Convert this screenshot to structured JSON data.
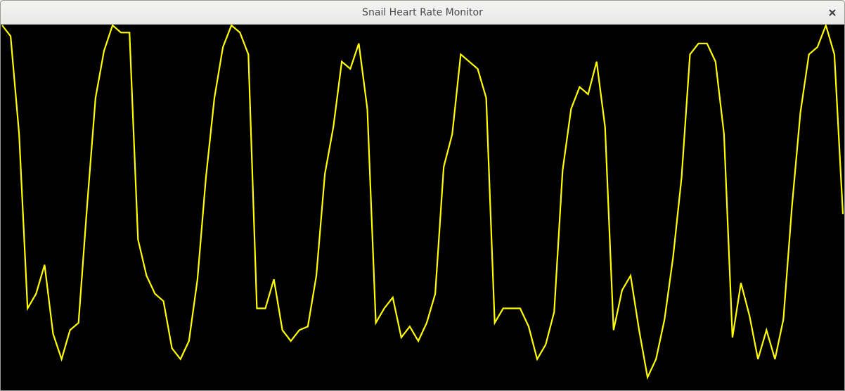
{
  "window": {
    "title": "Snail Heart Rate Monitor",
    "close_icon": "close-icon"
  },
  "colors": {
    "trace": "#ffff00",
    "background": "#000000"
  },
  "chart_data": {
    "type": "line",
    "xlabel": "",
    "ylabel": "",
    "grid": false,
    "legend": "none",
    "ylim": [
      0,
      100
    ],
    "series": [
      {
        "values": [
          100,
          97,
          70,
          22,
          26,
          34,
          15,
          8,
          16,
          18,
          50,
          80,
          93,
          100,
          98,
          98,
          41,
          31,
          26,
          24,
          11,
          8,
          13,
          30,
          58,
          80,
          94,
          100,
          98,
          92,
          22,
          22,
          30,
          16,
          13,
          16,
          17,
          31,
          59,
          72,
          90,
          88,
          95,
          77,
          18,
          22,
          25,
          14,
          17,
          13,
          18,
          26,
          61,
          70,
          92,
          90,
          88,
          80,
          18,
          22,
          22,
          22,
          17,
          8,
          12,
          21,
          60,
          77,
          83,
          81,
          90,
          72,
          16,
          27,
          31,
          16,
          3,
          8,
          19,
          36,
          58,
          92,
          95,
          95,
          90,
          70,
          14,
          29,
          20,
          8,
          16,
          8,
          19,
          50,
          76,
          92,
          94,
          100,
          92,
          48
        ]
      }
    ]
  }
}
